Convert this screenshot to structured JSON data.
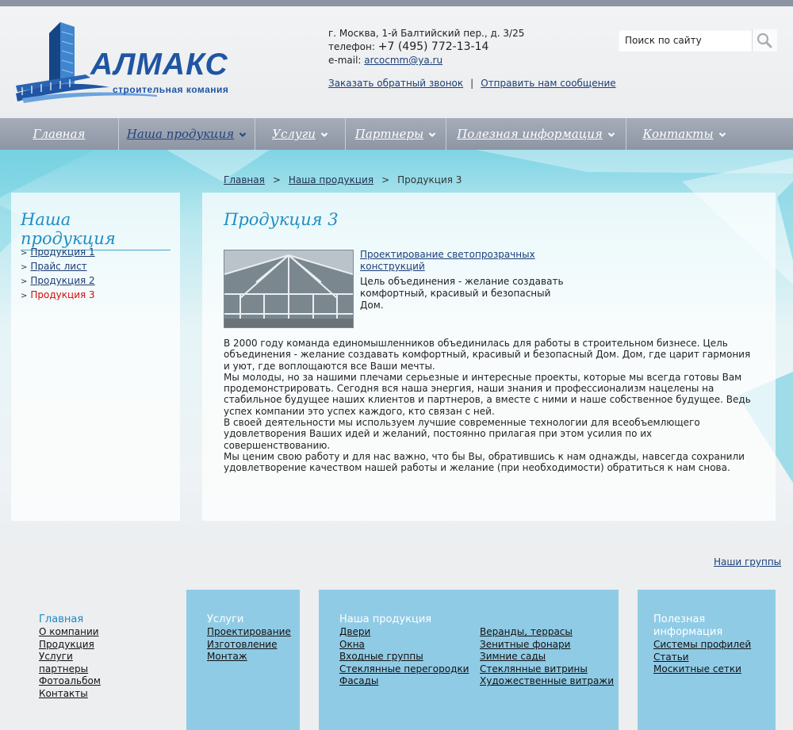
{
  "header": {
    "logo_word": "АЛМАКС",
    "logo_sub": "строительная комания",
    "address": "г. Москва, 1-й Балтийский пер., д. 3/25",
    "phone_label": "телефон:",
    "phone": "+7 (495) 772-13-14",
    "email_label": "e-mail:",
    "email": "arcocmm@ya.ru",
    "callback_link": "Заказать обратный звонок",
    "separator": "|",
    "message_link": "Отправить нам сообщение",
    "search_placeholder": "Поиск по сайту",
    "search_icon": "magnifier-icon"
  },
  "nav": {
    "items": [
      {
        "label": "Главная"
      },
      {
        "label": "Наша продукция"
      },
      {
        "label": "Услуги"
      },
      {
        "label": "Партнеры"
      },
      {
        "label": "Полезная информация"
      },
      {
        "label": "Контакты"
      }
    ],
    "active_color": "#23447f",
    "chevron_icon": "chevron-down-icon"
  },
  "breadcrumbs": {
    "home": "Главная",
    "section": "Наша продукция",
    "sep": ">",
    "current": "Продукция 3"
  },
  "sidebar": {
    "title": "Наша продукция",
    "marker": ">",
    "items": [
      {
        "label": "Продукция 1"
      },
      {
        "label": "Прайс лист"
      },
      {
        "label": "Продукция 2"
      },
      {
        "label": "Продукция 3"
      }
    ],
    "current_color": "#d80b0b"
  },
  "main": {
    "title": "Продукция 3",
    "teaser_title": "Проектирование светопрозрачных конструкций",
    "teaser_text": "Цель объединения - желание создавать комфортный, красивый и безопасный Дом.",
    "paragraphs": [
      "В 2000 году команда единомышленников объединилась для работы в строительном бизнесе. Цель объединения - желание создавать комфортный, красивый и безопасный Дом. Дом, где царит гармония и уют, где воплощаются все Ваши мечты.",
      "Мы молоды, но за нашими плечами серьезные и интересные проекты, которые мы всегда готовы Вам продемонстрировать. Сегодня вся наша энергия, наши знания и профессионализм нацелены на стабильное будущее наших клиентов и партнеров, а вместе с ними и наше собственное будущее. Ведь успех компании это успех каждого, кто связан с ней.",
      "В своей деятельности мы используем лучшие современные технологии для всеобъемлющего удовлетворения Ваших идей и желаний, постоянно прилагая при этом усилия по их совершенствованию.",
      "Мы ценим свою работу и для нас важно, что бы Вы, обратившись к нам однажды, навсегда сохранили удовлетворение качеством нашей работы и желание (при необходимости) обратиться к нам снова."
    ]
  },
  "groups_link": "Наши группы",
  "footer": {
    "col1": {
      "heading": "Главная",
      "items": [
        "О компании",
        "Продукция",
        "Услуги",
        "партнеры",
        "Фотоальбом",
        "Контакты"
      ]
    },
    "col2": {
      "heading": "Услуги",
      "items": [
        "Проектирование",
        "Изготовление",
        "Монтаж"
      ]
    },
    "col3": {
      "heading": "Наша продукция",
      "items_left": [
        "Двери",
        "Окна",
        "Входные группы",
        "Стеклянные перегородки",
        "Фасады"
      ],
      "items_right": [
        "Веранды, террасы",
        "Зенитные фонари",
        "Зимние сады",
        "Стеклянные витрины",
        "Художественные витражи"
      ]
    },
    "col4": {
      "heading": "Полезная информация",
      "items": [
        "Системы профилей",
        "Статьи",
        "Москитные сетки"
      ]
    },
    "panel_color": "#90cbe6"
  }
}
